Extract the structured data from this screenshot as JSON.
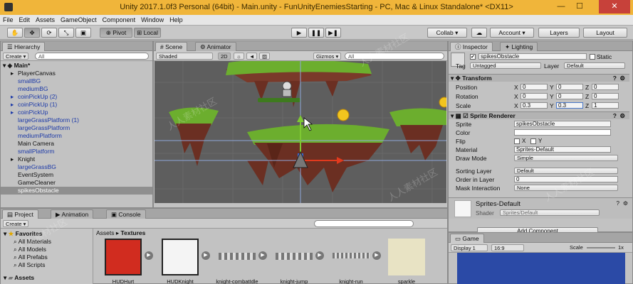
{
  "window": {
    "title": "Unity 2017.1.0f3 Personal (64bit) - Main.unity - FunUnityEnemiesStarting - PC, Mac & Linux Standalone* <DX11>",
    "minimize": "—",
    "maximize": "☐",
    "close": "✕"
  },
  "menu": [
    "File",
    "Edit",
    "Assets",
    "GameObject",
    "Component",
    "Window",
    "Help"
  ],
  "toolbar": {
    "pivot": "Pivot",
    "local": "Local",
    "collab": "Collab ▾",
    "account": "Account ▾",
    "layers": "Layers",
    "layout": "Layout"
  },
  "hierarchy": {
    "tab": "Hierarchy",
    "create": "Create ▾",
    "search_placeholder": "All",
    "scene_root": "Main*",
    "items": [
      {
        "label": "PlayerCanvas",
        "color": "black",
        "arrow": true
      },
      {
        "label": "smallBG",
        "color": "blue",
        "arrow": false
      },
      {
        "label": "mediumBG",
        "color": "blue",
        "arrow": false
      },
      {
        "label": "coinPickUp (2)",
        "color": "blue",
        "arrow": true
      },
      {
        "label": "coinPickUp (1)",
        "color": "blue",
        "arrow": true
      },
      {
        "label": "coinPickUp",
        "color": "blue",
        "arrow": true
      },
      {
        "label": "largeGrassPlatform (1)",
        "color": "blue",
        "arrow": false
      },
      {
        "label": "largeGrassPlatform",
        "color": "blue",
        "arrow": false
      },
      {
        "label": "mediumPlatform",
        "color": "blue",
        "arrow": false
      },
      {
        "label": "Main Camera",
        "color": "black",
        "arrow": false
      },
      {
        "label": "smallPlatform",
        "color": "blue",
        "arrow": false
      },
      {
        "label": "Knight",
        "color": "black",
        "arrow": true
      },
      {
        "label": "largeGrassBG",
        "color": "blue",
        "arrow": false
      },
      {
        "label": "EventSystem",
        "color": "black",
        "arrow": false
      },
      {
        "label": "GameCleaner",
        "color": "black",
        "arrow": false
      },
      {
        "label": "spikesObstacle",
        "color": "black",
        "arrow": false
      }
    ]
  },
  "scene": {
    "tab_scene": "Scene",
    "tab_animator": "Animator",
    "shading": "Shaded",
    "mode_2d": "2D",
    "gizmos": "Gizmos ▾",
    "search_placeholder": "All"
  },
  "project": {
    "tab_project": "Project",
    "tab_animation": "Animation",
    "tab_console": "Console",
    "create": "Create ▾",
    "favorites": "Favorites",
    "fav_items": [
      "All Materials",
      "All Models",
      "All Prefabs",
      "All Scripts"
    ],
    "assets_root": "Assets",
    "breadcrumb_assets": "Assets",
    "breadcrumb_sep": "▸",
    "breadcrumb_folder": "Textures",
    "assets": [
      "HUDHurt",
      "HUDKnight",
      "knight-combatIdle",
      "knight-jump",
      "knight-run",
      "sparkle"
    ]
  },
  "inspector": {
    "tab_inspector": "Inspector",
    "tab_lighting": "Lighting",
    "object_name": "spikesObstacle",
    "static_label": "Static",
    "tag_label": "Tag",
    "tag_value": "Untagged",
    "layer_label": "Layer",
    "layer_value": "Default",
    "transform": {
      "title": "Transform",
      "rows": [
        {
          "label": "Position",
          "x": "0",
          "y": "0",
          "z": "0"
        },
        {
          "label": "Rotation",
          "x": "0",
          "y": "0",
          "z": "0"
        },
        {
          "label": "Scale",
          "x": "0.3",
          "y": "0.3",
          "z": "1"
        }
      ]
    },
    "sprite_renderer": {
      "title": "Sprite Renderer",
      "sprite_label": "Sprite",
      "sprite_value": "spikesObstacle",
      "color_label": "Color",
      "flip_label": "Flip",
      "flip_x": "X",
      "flip_y": "Y",
      "material_label": "Material",
      "material_value": "Sprites-Default",
      "draw_mode_label": "Draw Mode",
      "draw_mode_value": "Simple",
      "sorting_layer_label": "Sorting Layer",
      "sorting_layer_value": "Default",
      "order_label": "Order in Layer",
      "order_value": "0",
      "mask_label": "Mask Interaction",
      "mask_value": "None"
    },
    "material": {
      "name": "Sprites-Default",
      "shader_label": "Shader",
      "shader_value": "Sprites/Default"
    },
    "add_component": "Add Component"
  },
  "game": {
    "tab": "Game",
    "display": "Display 1",
    "aspect": "16:9",
    "scale_label": "Scale",
    "scale_value": "1x"
  },
  "watermarks": [
    "人人素材社区",
    "人人素材社区",
    "人人素材社区",
    "人人素材社区",
    "人人素材社区"
  ],
  "colors": {
    "title_bar": "#f0b53a",
    "selection": "#8f8f8f",
    "scene_bg": "#5e5e5e",
    "grass": "#6cae2e",
    "dirt": "#6b2f22",
    "game_view": "#2b4aa6"
  }
}
